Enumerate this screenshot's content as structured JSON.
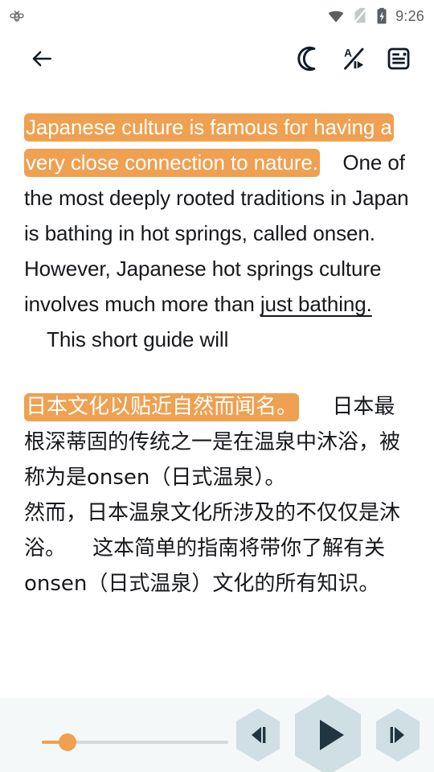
{
  "status_bar": {
    "notification_icon": "bee-icon",
    "wifi_icon": "wifi-icon",
    "sim_icon": "no-sim-icon",
    "battery_icon": "battery-charging-icon",
    "time": "9:26"
  },
  "app_bar": {
    "back_icon": "back-arrow-icon",
    "night_mode_icon": "moon-icon",
    "text_audio_icon": "text-to-speech-icon",
    "article_view_icon": "article-icon"
  },
  "colors": {
    "highlight": "#efa050",
    "highlight_text": "#ffffff",
    "body_text": "#16181c",
    "player_bar_bg": "#f4f8f9",
    "hex_button_bg": "#cfdfe4",
    "hex_button_bg_main": "#cfdfe4",
    "slider_accent": "#f0a04e",
    "slider_track": "#d6d9da",
    "icon_dark": "#111c28",
    "status_gray": "#5a5f63"
  },
  "reader": {
    "paragraph_en": {
      "highlighted": "Japanese culture is famous for having a very close connection to nature.",
      "gap1": "    ",
      "plain1": "One of the most deeply rooted traditions in Japan is bathing in hot springs, called onsen.",
      "break1": "\n",
      "plain2": "However, Japanese hot springs culture involves much more than ",
      "underlined": "just bathing.",
      "gap2": "    ",
      "plain3": "This short guide will"
    },
    "paragraph_zh": {
      "highlighted": "日本文化以贴近自然而闻名。",
      "gap1": "     ",
      "plain1": "日本最根深蒂固的传统之一是在温泉中沐浴，被称为是onsen（日式温泉）。",
      "break1": "\n",
      "plain2": "然而，日本温泉文化所涉及的不仅仅是沐浴。",
      "gap2": "    ",
      "plain3": "这本简单的指南将带你了解有关onsen（日式温泉）文化的所有知识。"
    }
  },
  "player": {
    "speed_slider": {
      "name": "speed-slider",
      "value_percent": 13
    },
    "previous_icon": "skip-previous-icon",
    "play_icon": "play-icon",
    "next_icon": "skip-next-icon"
  }
}
